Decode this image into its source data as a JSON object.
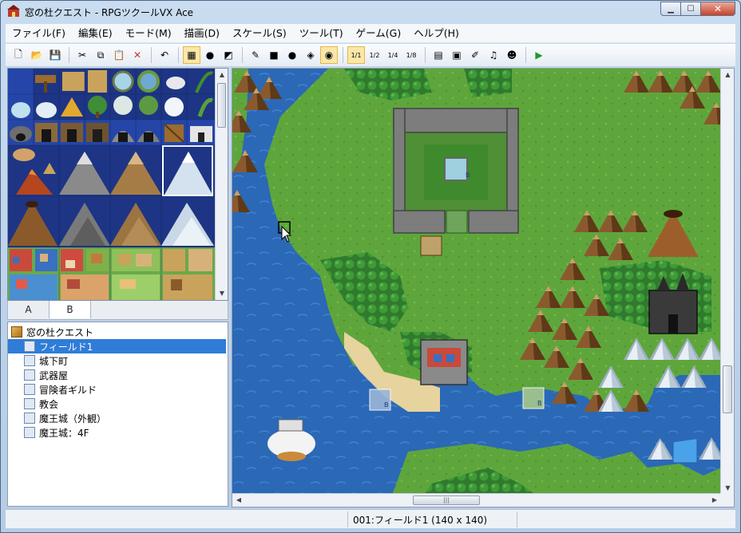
{
  "window": {
    "title": "窓の杜クエスト - RPGツクールVX Ace",
    "controls": {
      "minimize": "▁",
      "maximize": "☐",
      "close": "✕"
    }
  },
  "menu": [
    "ファイル(F)",
    "編集(E)",
    "モード(M)",
    "描画(D)",
    "スケール(S)",
    "ツール(T)",
    "ゲーム(G)",
    "ヘルプ(H)"
  ],
  "toolbar": {
    "groups": [
      [
        "new-project",
        "open-project",
        "save-project"
      ],
      [
        "cut",
        "copy",
        "paste",
        "delete"
      ],
      [
        "undo"
      ],
      [
        "map-layer",
        "event-layer",
        "region-layer"
      ],
      [
        "pencil",
        "rectangle",
        "ellipse",
        "fill",
        "shadow-pen"
      ],
      [
        "scale-1-1",
        "scale-1-2",
        "scale-1-4",
        "scale-1-8"
      ],
      [
        "database",
        "resource-manager",
        "script-editor",
        "sound-test",
        "character-generator"
      ],
      [
        "playtest"
      ]
    ],
    "glyphs": {
      "new-project": "🗋",
      "open-project": "📂",
      "save-project": "💾",
      "cut": "✂",
      "copy": "⧉",
      "paste": "📋",
      "delete": "✕",
      "undo": "↶",
      "map-layer": "▦",
      "event-layer": "●",
      "region-layer": "◩",
      "pencil": "✎",
      "rectangle": "■",
      "ellipse": "●",
      "fill": "◈",
      "shadow-pen": "◉",
      "scale-1-1": "1/1",
      "scale-1-2": "1/2",
      "scale-1-4": "1/4",
      "scale-1-8": "1/8",
      "database": "▤",
      "resource-manager": "▣",
      "script-editor": "✐",
      "sound-test": "♫",
      "character-generator": "☻",
      "playtest": "▶"
    },
    "active": [
      "map-layer",
      "shadow-pen",
      "scale-1-1"
    ]
  },
  "palette_tabs": [
    {
      "label": "A",
      "selected": false
    },
    {
      "label": "B",
      "selected": true
    }
  ],
  "map_tree": {
    "root": "窓の杜クエスト",
    "maps": [
      {
        "label": "フィールド1",
        "selected": true
      },
      {
        "label": "城下町",
        "selected": false
      },
      {
        "label": "武器屋",
        "selected": false
      },
      {
        "label": "冒険者ギルド",
        "selected": false
      },
      {
        "label": "教会",
        "selected": false
      },
      {
        "label": "魔王城（外観）",
        "selected": false
      },
      {
        "label": "魔王城：4F",
        "selected": false
      }
    ]
  },
  "map_events": [
    "B",
    "B",
    "B"
  ],
  "status": {
    "text": "001:フィールド1 (140 x 140)"
  },
  "colors": {
    "accent": "#2f7cd9",
    "water_deep": "#1f4f9a",
    "water": "#2e6fbe",
    "grass": "#5da43a",
    "forest": "#2e7a2a",
    "sand": "#e8d6a0",
    "mountain": "#8b5a2b",
    "snow": "#e6eef5"
  }
}
